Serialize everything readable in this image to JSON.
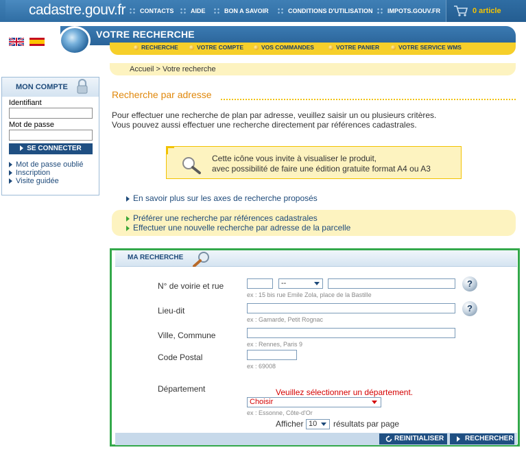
{
  "site": {
    "logo": "cadastre.gouv.fr"
  },
  "topnav": [
    {
      "label": "CONTACTS"
    },
    {
      "label": "AIDE"
    },
    {
      "label": "BON A SAVOIR"
    },
    {
      "label": "CONDITIONS D'UTILISATION"
    },
    {
      "label": "IMPOTS.GOUV.FR"
    }
  ],
  "cart": {
    "label": "0 article"
  },
  "section": {
    "title": "VOTRE RECHERCHE"
  },
  "subnav": [
    {
      "label": "RECHERCHE"
    },
    {
      "label": "VOTRE COMPTE"
    },
    {
      "label": "VOS COMMANDES"
    },
    {
      "label": "VOTRE PANIER"
    },
    {
      "label": "VOTRE SERVICE WMS"
    }
  ],
  "breadcrumb": "Accueil > Votre recherche",
  "account": {
    "title": "MON COMPTE",
    "identifiant_label": "Identifiant",
    "password_label": "Mot de passe",
    "login_button": "SE CONNECTER",
    "links": [
      {
        "label": "Mot de passe oublié"
      },
      {
        "label": "Inscription"
      },
      {
        "label": "Visite guidée"
      }
    ]
  },
  "main": {
    "title": "Recherche par adresse",
    "intro1": "Pour effectuer une recherche de plan par adresse, veuillez saisir un ou plusieurs critères.",
    "intro2": "Vous pouvez aussi effectuer une recherche directement par références cadastrales.",
    "info1": "Cette icône vous invite à visualiser le produit,",
    "info2": "avec possibilité de faire une édition gratuite format A4 ou A3",
    "more_link": "En savoir plus sur les axes de recherche proposés",
    "alt_link1": "Préférer une recherche par références cadastrales",
    "alt_link2": "Effectuer une nouvelle recherche par adresse de la parcelle"
  },
  "search": {
    "title": "MA RECHERCHE",
    "voirie_label": "N° de voirie et rue",
    "voirie_select": "--",
    "voirie_hint": "ex : 15 bis rue Emile Zola, place de la Bastille",
    "lieudit_label": "Lieu-dit",
    "lieudit_hint": "ex : Gamarde, Petit Rognac",
    "ville_label": "Ville, Commune",
    "ville_hint": "ex : Rennes, Paris 9",
    "cp_label": "Code Postal",
    "cp_hint": "ex : 69008",
    "error": "Veuillez sélectionner un département.",
    "dept_label": "Département",
    "dept_select": "Choisir",
    "dept_hint": "ex : Essonne, Côte-d'Or",
    "afficher_label": "Afficher",
    "afficher_value": "10",
    "results_label": "résultats par page",
    "reset_button": "REINITIALISER",
    "search_button": "RECHERCHER"
  },
  "colors": {
    "brand_blue": "#2f6da3",
    "accent_yellow": "#f6cf2a",
    "title_orange": "#e0870a",
    "error_red": "#d40000",
    "panel_border_green": "#33a84a"
  }
}
